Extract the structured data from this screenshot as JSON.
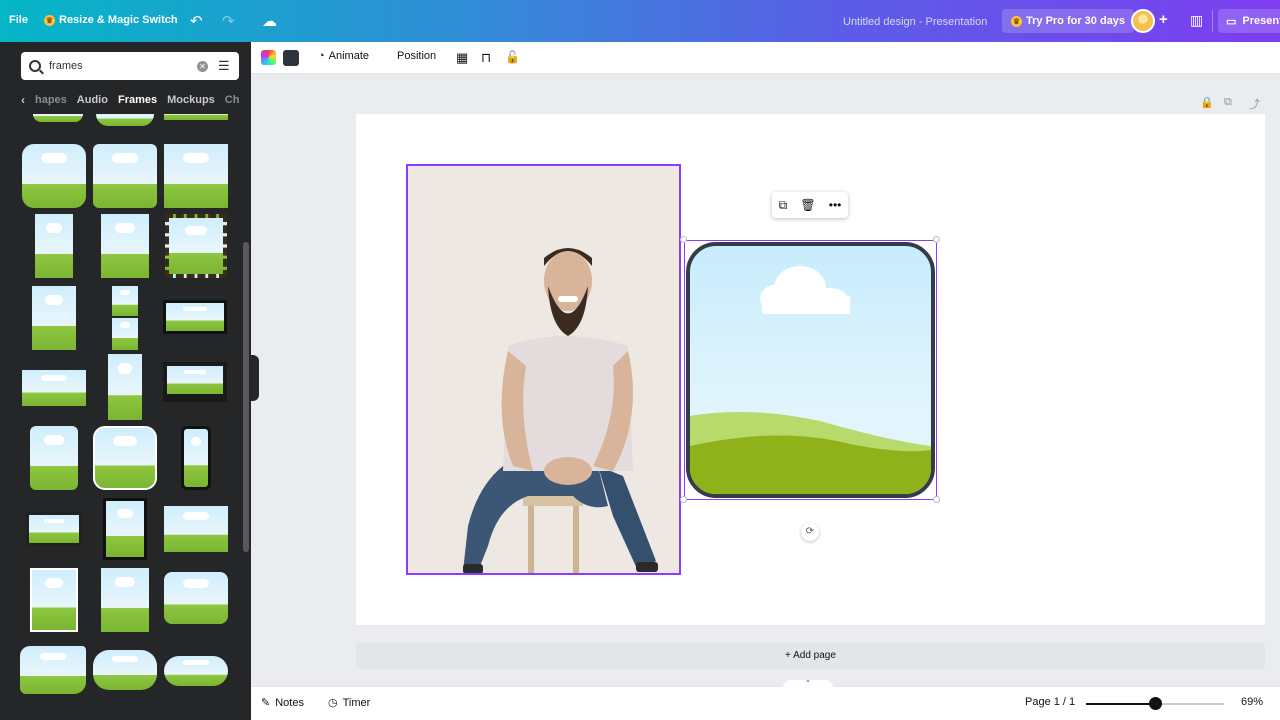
{
  "topbar": {
    "file_label": "File",
    "resize_label": "Resize & Magic Switch",
    "design_title": "Untitled design - Presentation",
    "pro_label": "Try Pro for 30 days",
    "present_label": "Present",
    "icons": [
      "crown-icon",
      "undo-icon",
      "redo-icon",
      "cloud-save-icon",
      "avatar",
      "plus-icon",
      "bar-chart-icon",
      "present-icon"
    ]
  },
  "sidebar": {
    "search_value": "frames",
    "categories": [
      "hapes",
      "Audio",
      "Frames",
      "Mockups",
      "Ch"
    ],
    "active_category": "Frames"
  },
  "toolbar": {
    "animate_label": "Animate",
    "position_label": "Position",
    "color_swatch": "#2d3440"
  },
  "canvas": {
    "add_page_label": "+ Add page",
    "accent_color": "#8b3dff",
    "frame_border_color": "#343c48"
  },
  "bottombar": {
    "notes_label": "Notes",
    "timer_label": "Timer",
    "page_label": "Page 1 / 1",
    "zoom_label": "69%",
    "zoom_fraction": 0.5
  }
}
